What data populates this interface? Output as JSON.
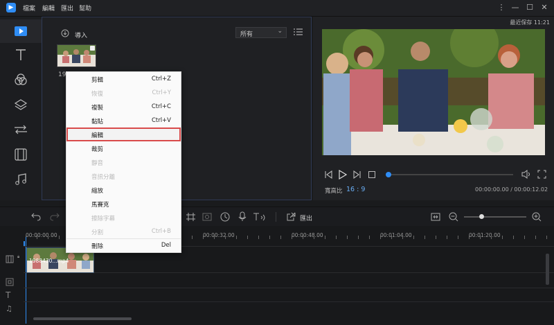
{
  "titlebar": {
    "menus": [
      "檔案",
      "編輯",
      "匯出",
      "幫助"
    ]
  },
  "media": {
    "import_label": "導入",
    "filter_value": "所有",
    "clip_name": "1988"
  },
  "preview": {
    "saved_label": "最近保存 11:21",
    "aspect_label": "寬高比",
    "aspect_value": "16 : 9",
    "time_display": "00:00:00.00 / 00:00:12.02",
    "progress": 0.0
  },
  "toolbar": {
    "export_label": "匯出"
  },
  "timeline": {
    "marks": [
      "00:00:00.00",
      "00:00:32.00",
      "00:00:48.00",
      "00:01:04.00",
      "00:01:20.00"
    ],
    "clip_label": "1988430...mp4"
  },
  "context_menu": {
    "items": [
      {
        "label": "剪輯",
        "shortcut": "Ctrl+Z",
        "disabled": false
      },
      {
        "label": "恢復",
        "shortcut": "Ctrl+Y",
        "disabled": true
      },
      {
        "label": "複製",
        "shortcut": "Ctrl+C",
        "disabled": false
      },
      {
        "label": "黏貼",
        "shortcut": "Ctrl+V",
        "disabled": false
      },
      {
        "label": "編輯",
        "shortcut": "",
        "disabled": false,
        "highlight": true
      },
      {
        "label": "裁剪",
        "shortcut": "",
        "disabled": false
      },
      {
        "label": "靜音",
        "shortcut": "",
        "disabled": true
      },
      {
        "label": "音訊分離",
        "shortcut": "",
        "disabled": true
      },
      {
        "label": "縮放",
        "shortcut": "",
        "disabled": false
      },
      {
        "label": "馬賽克",
        "shortcut": "",
        "disabled": false
      },
      {
        "label": "擦除字幕",
        "shortcut": "",
        "disabled": true
      },
      {
        "label": "分割",
        "shortcut": "Ctrl+B",
        "disabled": true
      },
      {
        "label": "刪除",
        "shortcut": "Del",
        "disabled": false
      }
    ]
  },
  "colors": {
    "accent": "#2f8df5",
    "highlight_border": "#d94a4a"
  }
}
